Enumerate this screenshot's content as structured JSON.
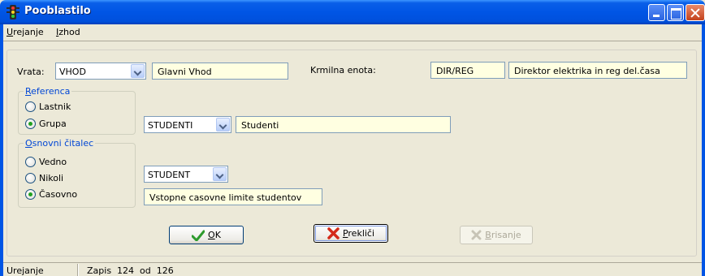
{
  "window": {
    "title": "Pooblastilo"
  },
  "menu": {
    "items": [
      "Urejanje",
      "Izhod"
    ]
  },
  "vrata": {
    "label": "Vrata:",
    "code": "VHOD",
    "name": "Glavni Vhod"
  },
  "krmilna": {
    "label": "Krmilna enota:",
    "code": "DIR/REG",
    "name": "Direktor elektrika in reg del.časa"
  },
  "referenca": {
    "title": "Referenca",
    "options": [
      "Lastnik",
      "Grupa"
    ],
    "selected": "Grupa",
    "code": "STUDENTI",
    "name": "Studenti"
  },
  "citalec": {
    "title": "Osnovni čitalec",
    "options": [
      "Vedno",
      "Nikoli",
      "Časovno"
    ],
    "selected": "Časovno",
    "code": "STUDENT",
    "name": "Vstopne casovne limite studentov"
  },
  "buttons": {
    "ok": "OK",
    "cancel": "Prekliči",
    "delete": "Brisanje"
  },
  "status": {
    "mode": "Urejanje",
    "record": "Zapis  124  od  126"
  },
  "colors": {
    "titlebar": "#0055e5",
    "field_bg": "#ffffe1",
    "group_title": "#0046d5"
  }
}
